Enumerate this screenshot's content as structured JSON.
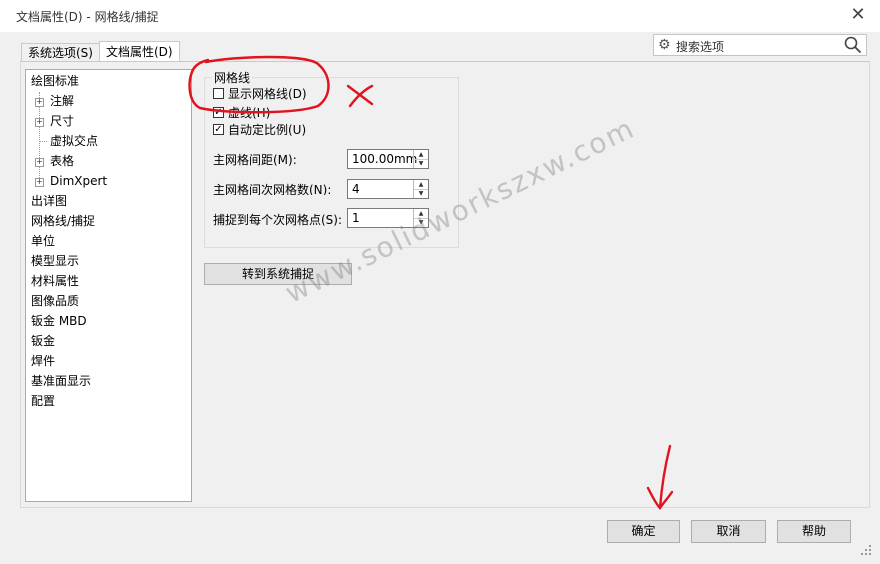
{
  "window": {
    "title": "文档属性(D) - 网格线/捕捉",
    "close_glyph": "✕"
  },
  "tabs": [
    {
      "label": "系统选项(S)"
    },
    {
      "label": "文档属性(D)"
    }
  ],
  "search": {
    "placeholder": "搜索选项"
  },
  "tree": [
    {
      "label": "绘图标准"
    },
    {
      "label": "注解",
      "expand": "+"
    },
    {
      "label": "尺寸",
      "expand": "+"
    },
    {
      "label": "虚拟交点"
    },
    {
      "label": "表格",
      "expand": "+"
    },
    {
      "label": "DimXpert",
      "expand": "+"
    },
    {
      "label": "出详图"
    },
    {
      "label": "网格线/捕捉"
    },
    {
      "label": "单位"
    },
    {
      "label": "模型显示"
    },
    {
      "label": "材料属性"
    },
    {
      "label": "图像品质"
    },
    {
      "label": "钣金 MBD"
    },
    {
      "label": "钣金"
    },
    {
      "label": "焊件"
    },
    {
      "label": "基准面显示"
    },
    {
      "label": "配置"
    }
  ],
  "grid": {
    "group_title": "网格线",
    "show_grid": {
      "label": "显示网格线(D)",
      "checked": false
    },
    "dash": {
      "label": "虚线(H)",
      "checked": true
    },
    "auto_scale": {
      "label": "自动定比例(U)",
      "checked": true
    },
    "major_spacing": {
      "label": "主网格间距(M):",
      "value": "100.00mm"
    },
    "minor_per_major": {
      "label": "主网格间次网格数(N):",
      "value": "4"
    },
    "snap_points": {
      "label": "捕捉到每个次网格点(S):",
      "value": "1"
    },
    "check_mark": "✓",
    "spin_up": "▲",
    "spin_down": "▼"
  },
  "goto_system_snap": {
    "label": "转到系统捕捉"
  },
  "footer": {
    "ok": "确定",
    "cancel": "取消",
    "help": "帮助"
  },
  "annotation": {
    "x_mark": "X",
    "watermark": "www.solidworkszxw.com"
  },
  "colors": {
    "annotation_red": "#e0141e",
    "selected_tab_bg": "#ffffff"
  }
}
